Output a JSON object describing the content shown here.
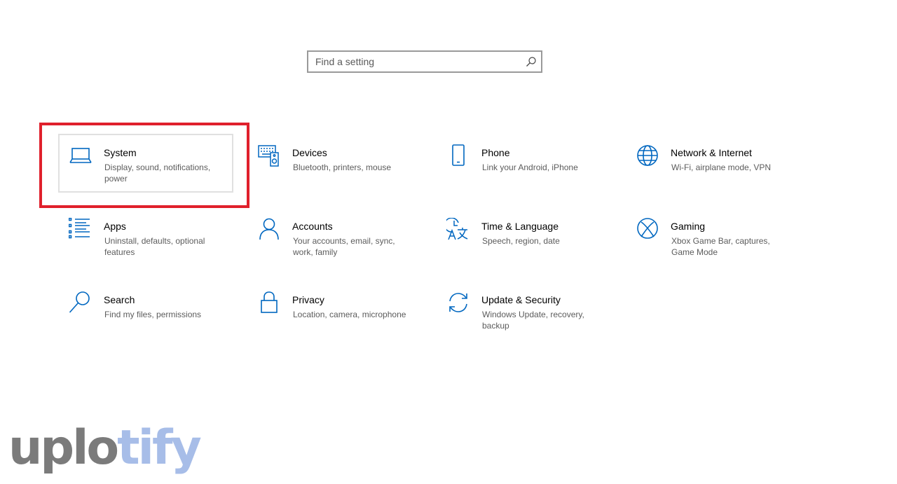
{
  "search": {
    "placeholder": "Find a setting"
  },
  "accent_color": "#0067c0",
  "highlight_color": "#e0202c",
  "tiles": [
    {
      "title": "System",
      "desc": "Display, sound, notifications, power",
      "icon": "laptop-icon"
    },
    {
      "title": "Devices",
      "desc": "Bluetooth, printers, mouse",
      "icon": "keyboard-speaker-icon"
    },
    {
      "title": "Phone",
      "desc": "Link your Android, iPhone",
      "icon": "phone-icon"
    },
    {
      "title": "Network & Internet",
      "desc": "Wi-Fi, airplane mode, VPN",
      "icon": "globe-icon"
    },
    {
      "title": "Apps",
      "desc": "Uninstall, defaults, optional features",
      "icon": "apps-list-icon"
    },
    {
      "title": "Accounts",
      "desc": "Your accounts, email, sync, work, family",
      "icon": "person-icon"
    },
    {
      "title": "Time & Language",
      "desc": "Speech, region, date",
      "icon": "time-language-icon"
    },
    {
      "title": "Gaming",
      "desc": "Xbox Game Bar, captures, Game Mode",
      "icon": "xbox-icon"
    },
    {
      "title": "Search",
      "desc": "Find my files, permissions",
      "icon": "search-icon"
    },
    {
      "title": "Privacy",
      "desc": "Location, camera, microphone",
      "icon": "lock-icon"
    },
    {
      "title": "Update & Security",
      "desc": "Windows Update, recovery, backup",
      "icon": "sync-icon"
    }
  ],
  "watermark": {
    "part1": "uplo",
    "part2": "tify"
  }
}
